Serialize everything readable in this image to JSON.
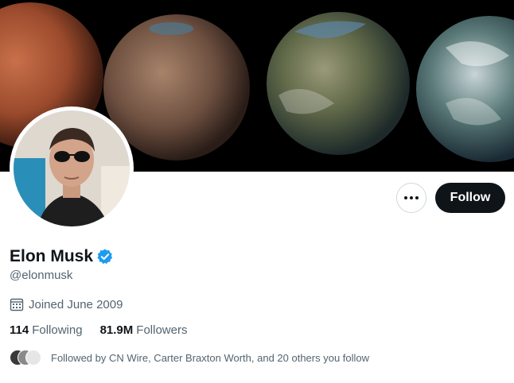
{
  "profile": {
    "name": "Elon Musk",
    "handle": "@elonmusk",
    "joined": "Joined June 2009",
    "verified": true
  },
  "actions": {
    "follow_label": "Follow",
    "more_icon": "ellipsis-icon"
  },
  "stats": {
    "following_count": "114",
    "following_label": "Following",
    "followers_count": "81.9M",
    "followers_label": "Followers"
  },
  "followed_by": {
    "text": "Followed by CN Wire, Carter Braxton Worth, and 20 others you follow"
  },
  "colors": {
    "accent": "#1d9bf0",
    "button_dark": "#0f1419",
    "muted_text": "#536471",
    "border": "#cfd9de"
  }
}
